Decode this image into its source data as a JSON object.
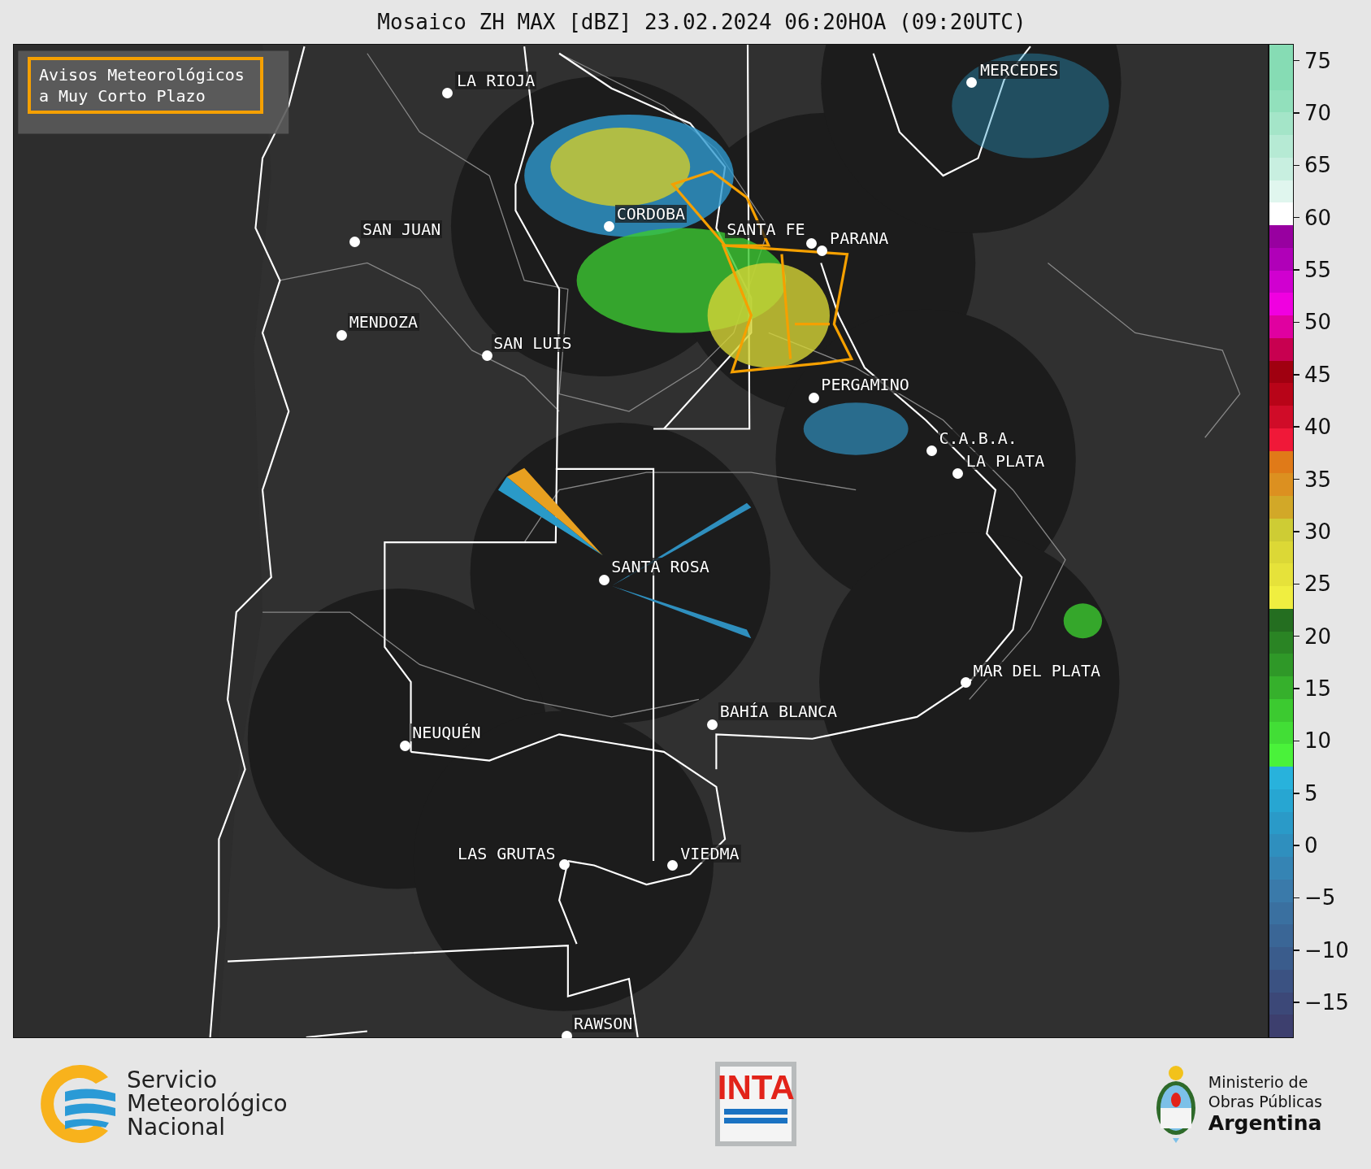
{
  "title": "Mosaico ZH MAX [dBZ] 23.02.2024 06:20HOA (09:20UTC)",
  "legend": {
    "lines": [
      "Avisos Meteorológicos",
      "a Muy Corto Plazo"
    ]
  },
  "cities": [
    {
      "name": "LA RIOJA"
    },
    {
      "name": "MERCEDES"
    },
    {
      "name": "SAN JUAN"
    },
    {
      "name": "CORDOBA"
    },
    {
      "name": "SANTA FE"
    },
    {
      "name": "PARANA"
    },
    {
      "name": "MENDOZA"
    },
    {
      "name": "SAN LUIS"
    },
    {
      "name": "PERGAMINO"
    },
    {
      "name": "C.A.B.A."
    },
    {
      "name": "LA PLATA"
    },
    {
      "name": "SANTA ROSA"
    },
    {
      "name": "MAR DEL PLATA"
    },
    {
      "name": "BAHÍA BLANCA"
    },
    {
      "name": "NEUQUÉN"
    },
    {
      "name": "LAS GRUTAS"
    },
    {
      "name": "VIEDMA"
    },
    {
      "name": "RAWSON"
    }
  ],
  "colorbar": {
    "ticks": [
      "75",
      "70",
      "65",
      "60",
      "55",
      "50",
      "45",
      "40",
      "35",
      "30",
      "25",
      "20",
      "15",
      "10",
      "5",
      "0",
      "−5",
      "−10",
      "−15"
    ]
  },
  "footer": {
    "smn": [
      "Servicio",
      "Meteorológico",
      "Nacional"
    ],
    "inta": "INTA",
    "ministry": [
      "Ministerio de",
      "Obras Públicas",
      "Argentina"
    ]
  }
}
